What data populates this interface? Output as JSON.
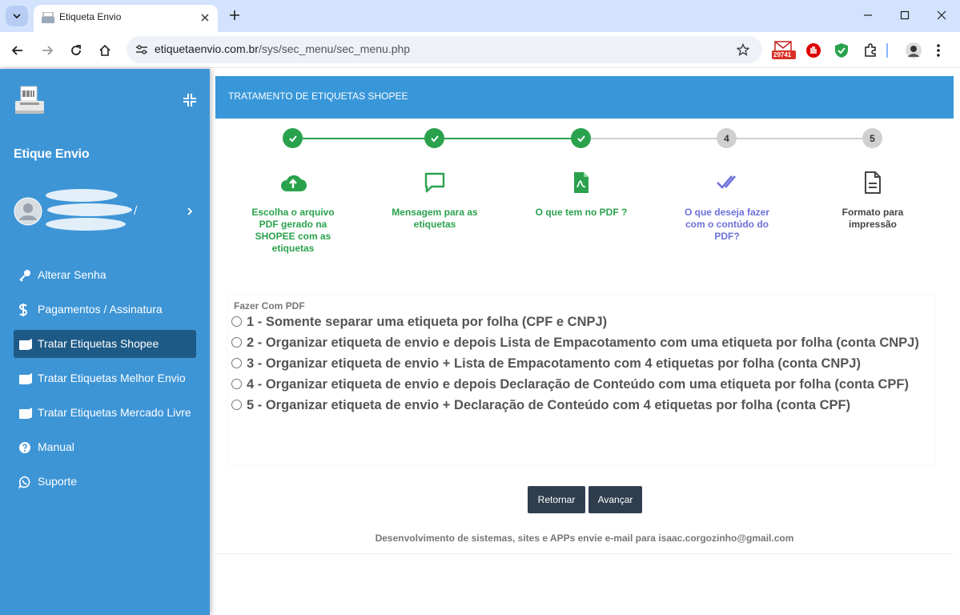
{
  "browser": {
    "tab_title": "Etiqueta Envio",
    "url_host": "etiquetaenvio.com.br",
    "url_path": "/sys/sec_menu/sec_menu.php",
    "ext_badge": "29741"
  },
  "sidebar": {
    "brand": "Etique Envio",
    "user_separator": "/",
    "items": [
      {
        "label": "Alterar Senha",
        "icon": "key-icon"
      },
      {
        "label": "Pagamentos / Assinatura",
        "icon": "dollar-icon"
      },
      {
        "label": "Tratar Etiquetas Shopee",
        "icon": "tag-icon",
        "active": true
      },
      {
        "label": "Tratar Etiquetas Melhor Envio",
        "icon": "tag-icon"
      },
      {
        "label": "Tratar Etiquetas Mercado Livre",
        "icon": "tag-icon"
      },
      {
        "label": "Manual",
        "icon": "question-icon"
      },
      {
        "label": "Suporte",
        "icon": "whatsapp-icon"
      }
    ]
  },
  "main": {
    "title": "TRATAMENTO DE ETIQUETAS SHOPEE",
    "steps": [
      {
        "number": "1",
        "status": "done",
        "icon": "cloud-upload-icon",
        "label": "Escolha o arquivo PDF gerado na SHOPEE com as etiquetas"
      },
      {
        "number": "2",
        "status": "done",
        "icon": "message-icon",
        "label": "Mensagem para as etiquetas"
      },
      {
        "number": "3",
        "status": "done",
        "icon": "pdf-file-icon",
        "label": "O que tem no PDF ?"
      },
      {
        "number": "4",
        "status": "current",
        "icon": "double-check-icon",
        "label": "O que deseja fazer com o contúdo do PDF?"
      },
      {
        "number": "5",
        "status": "todo",
        "icon": "document-icon",
        "label": "Formato para impressão"
      }
    ],
    "options_heading": "Fazer Com PDF",
    "options": [
      "1 - Somente separar uma etiqueta por folha (CPF e CNPJ)",
      "2 - Organizar etiqueta de envio e depois Lista de Empacotamento com uma etiqueta por folha (conta CNPJ)",
      "3 - Organizar etiqueta de envio + Lista de Empacotamento com 4 etiquetas por folha (conta CNPJ)",
      "4 - Organizar etiqueta de envio e depois Declaração de Conteúdo com uma etiqueta por folha (conta CPF)",
      "5 - Organizar etiqueta de envio + Declaração de Conteúdo com 4 etiquetas por folha (conta CPF)"
    ],
    "back_label": "Retornar",
    "next_label": "Avançar",
    "footer": "Desenvolvimento de sistemas, sites e APPs envie e-mail para isaac.corgozinho@gmail.com"
  },
  "colors": {
    "sidebar": "#3d95d6",
    "title_bar": "#3897d9",
    "done": "#2aa24d",
    "current": "#6c70d8",
    "button": "#2f3e4f"
  }
}
